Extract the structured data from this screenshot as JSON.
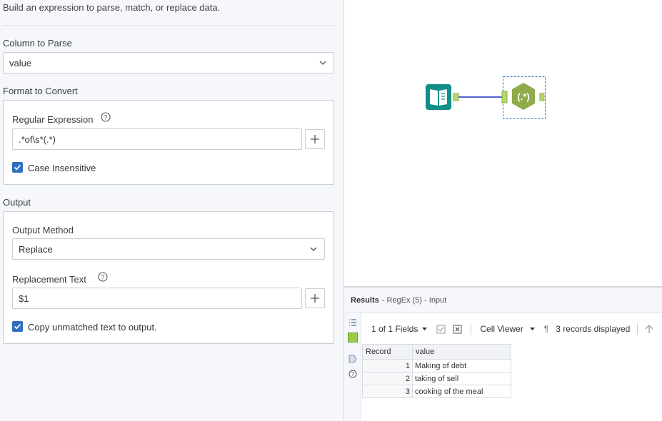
{
  "config": {
    "description": "Build an expression to parse, match, or replace data.",
    "column_to_parse": {
      "label": "Column to Parse",
      "value": "value"
    },
    "format_to_convert": {
      "label": "Format to Convert",
      "regex_label": "Regular Expression",
      "regex_value": ".*of\\s*(.*)",
      "case_insensitive_label": "Case Insensitive",
      "case_insensitive_checked": true
    },
    "output": {
      "label": "Output",
      "method_label": "Output Method",
      "method_value": "Replace",
      "replacement_label": "Replacement Text",
      "replacement_value": "$1",
      "copy_unmatched_label": "Copy unmatched text to output.",
      "copy_unmatched_checked": true
    }
  },
  "canvas": {
    "tools": [
      {
        "name": "input-data-tool",
        "icon": "book-icon",
        "color": "#0f8f87"
      },
      {
        "name": "regex-tool",
        "icon": "regex-icon",
        "label": "(.*)",
        "color": "#8fab4a",
        "selected": true
      }
    ],
    "connection_color": "#1f2fbf"
  },
  "results": {
    "title": "Results",
    "subtitle": "- RegEx (5) - Input",
    "fields_label": "1 of 1 Fields",
    "cell_viewer_label": "Cell Viewer",
    "pilcrow": "¶",
    "records_label": "3 records displayed",
    "columns": [
      "Record",
      "value"
    ],
    "rows": [
      {
        "record": "1",
        "value": "Making of debt"
      },
      {
        "record": "2",
        "value": "taking of sell"
      },
      {
        "record": "3",
        "value": "cooking of the meal"
      }
    ]
  },
  "colors": {
    "accent": "#2f6fbf",
    "panel_bg": "#f5f7fa"
  }
}
